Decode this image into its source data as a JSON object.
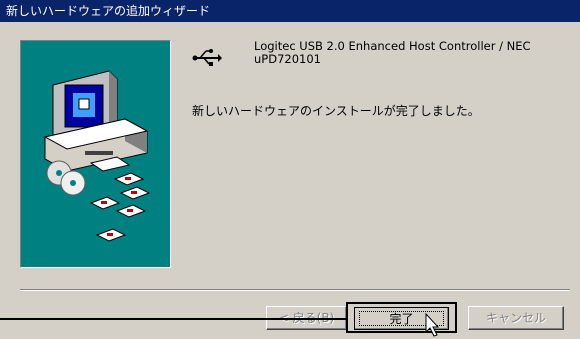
{
  "window": {
    "title": "新しいハードウェアの追加ウィザード"
  },
  "device": {
    "name": "Logitec USB 2.0 Enhanced Host Controller / NEC uPD720101"
  },
  "message": "新しいハードウェアのインストールが完了しました。",
  "buttons": {
    "back": "< 戻る(B)",
    "finish": "完了",
    "cancel": "キャンセル"
  },
  "colors": {
    "title_bar": "#0a246a",
    "wizard_panel": "#008080",
    "window_bg": "#d4d0c8"
  },
  "icons": {
    "device": "usb-icon",
    "wizard": "computer-with-discs-illustration",
    "pointer": "mouse-cursor-icon"
  }
}
